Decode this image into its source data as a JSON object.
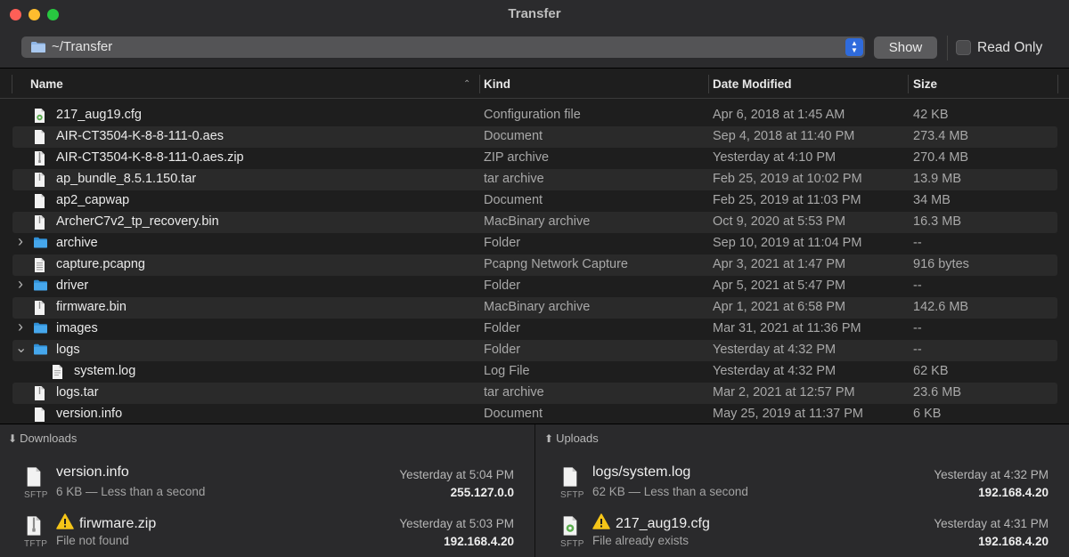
{
  "window": {
    "title": "Transfer"
  },
  "toolbar": {
    "path": "~/Transfer",
    "show_label": "Show",
    "read_only_label": "Read Only",
    "read_only_checked": false
  },
  "columns": {
    "name": "Name",
    "kind": "Kind",
    "date": "Date Modified",
    "size": "Size"
  },
  "files": [
    {
      "name": "217_aug19.cfg",
      "kind": "Configuration file",
      "date": "Apr 6, 2018 at 1:45 AM",
      "size": "42 KB",
      "icon": "config-file-icon"
    },
    {
      "name": "AIR-CT3504-K-8-8-111-0.aes",
      "kind": "Document",
      "date": "Sep 4, 2018 at 11:40 PM",
      "size": "273.4 MB",
      "icon": "document-icon"
    },
    {
      "name": "AIR-CT3504-K-8-8-111-0.aes.zip",
      "kind": "ZIP archive",
      "date": "Yesterday at 4:10 PM",
      "size": "270.4 MB",
      "icon": "zip-archive-icon"
    },
    {
      "name": "ap_bundle_8.5.1.150.tar",
      "kind": "tar archive",
      "date": "Feb 25, 2019 at 10:02 PM",
      "size": "13.9 MB",
      "icon": "archive-icon"
    },
    {
      "name": "ap2_capwap",
      "kind": "Document",
      "date": "Feb 25, 2019 at 11:03 PM",
      "size": "34 MB",
      "icon": "document-icon"
    },
    {
      "name": "ArcherC7v2_tp_recovery.bin",
      "kind": "MacBinary archive",
      "date": "Oct 9, 2020 at 5:53 PM",
      "size": "16.3 MB",
      "icon": "archive-icon"
    },
    {
      "name": "archive",
      "kind": "Folder",
      "date": "Sep 10, 2019 at 11:04 PM",
      "size": "--",
      "icon": "folder-icon",
      "disclosure": "collapsed"
    },
    {
      "name": "capture.pcapng",
      "kind": "Pcapng Network Capture",
      "date": "Apr 3, 2021 at 1:47 PM",
      "size": "916 bytes",
      "icon": "capture-file-icon"
    },
    {
      "name": "driver",
      "kind": "Folder",
      "date": "Apr 5, 2021 at 5:47 PM",
      "size": "--",
      "icon": "folder-icon",
      "disclosure": "collapsed"
    },
    {
      "name": "firmware.bin",
      "kind": "MacBinary archive",
      "date": "Apr 1, 2021 at 6:58 PM",
      "size": "142.6 MB",
      "icon": "archive-icon"
    },
    {
      "name": "images",
      "kind": "Folder",
      "date": "Mar 31, 2021 at 11:36 PM",
      "size": "--",
      "icon": "folder-icon",
      "disclosure": "collapsed"
    },
    {
      "name": "logs",
      "kind": "Folder",
      "date": "Yesterday at 4:32 PM",
      "size": "--",
      "icon": "folder-icon",
      "disclosure": "expanded"
    },
    {
      "name": "system.log",
      "kind": "Log File",
      "date": "Yesterday at 4:32 PM",
      "size": "62 KB",
      "icon": "log-file-icon",
      "indent": 1
    },
    {
      "name": "logs.tar",
      "kind": "tar archive",
      "date": "Mar 2, 2021 at 12:57 PM",
      "size": "23.6 MB",
      "icon": "archive-icon"
    },
    {
      "name": "version.info",
      "kind": "Document",
      "date": "May 25, 2019 at 11:37 PM",
      "size": "6 KB",
      "icon": "document-icon"
    }
  ],
  "downloads": {
    "title": "Downloads",
    "items": [
      {
        "name": "version.info",
        "detail": "6 KB — Less than a second",
        "when": "Yesterday at 5:04 PM",
        "host": "255.127.0.0",
        "protocol": "SFTP",
        "warning": false,
        "icon": "document-icon"
      },
      {
        "name": "firwmare.zip",
        "detail": "File not found",
        "when": "Yesterday at 5:03 PM",
        "host": "192.168.4.20",
        "protocol": "TFTP",
        "warning": true,
        "icon": "zip-archive-icon"
      }
    ]
  },
  "uploads": {
    "title": "Uploads",
    "items": [
      {
        "name": "logs/system.log",
        "detail": "62 KB — Less than a second",
        "when": "Yesterday at 4:32 PM",
        "host": "192.168.4.20",
        "protocol": "SFTP",
        "warning": false,
        "icon": "document-icon"
      },
      {
        "name": "217_aug19.cfg",
        "detail": "File already exists",
        "when": "Yesterday at 4:31 PM",
        "host": "192.168.4.20",
        "protocol": "SFTP",
        "warning": true,
        "icon": "config-file-icon"
      }
    ]
  }
}
